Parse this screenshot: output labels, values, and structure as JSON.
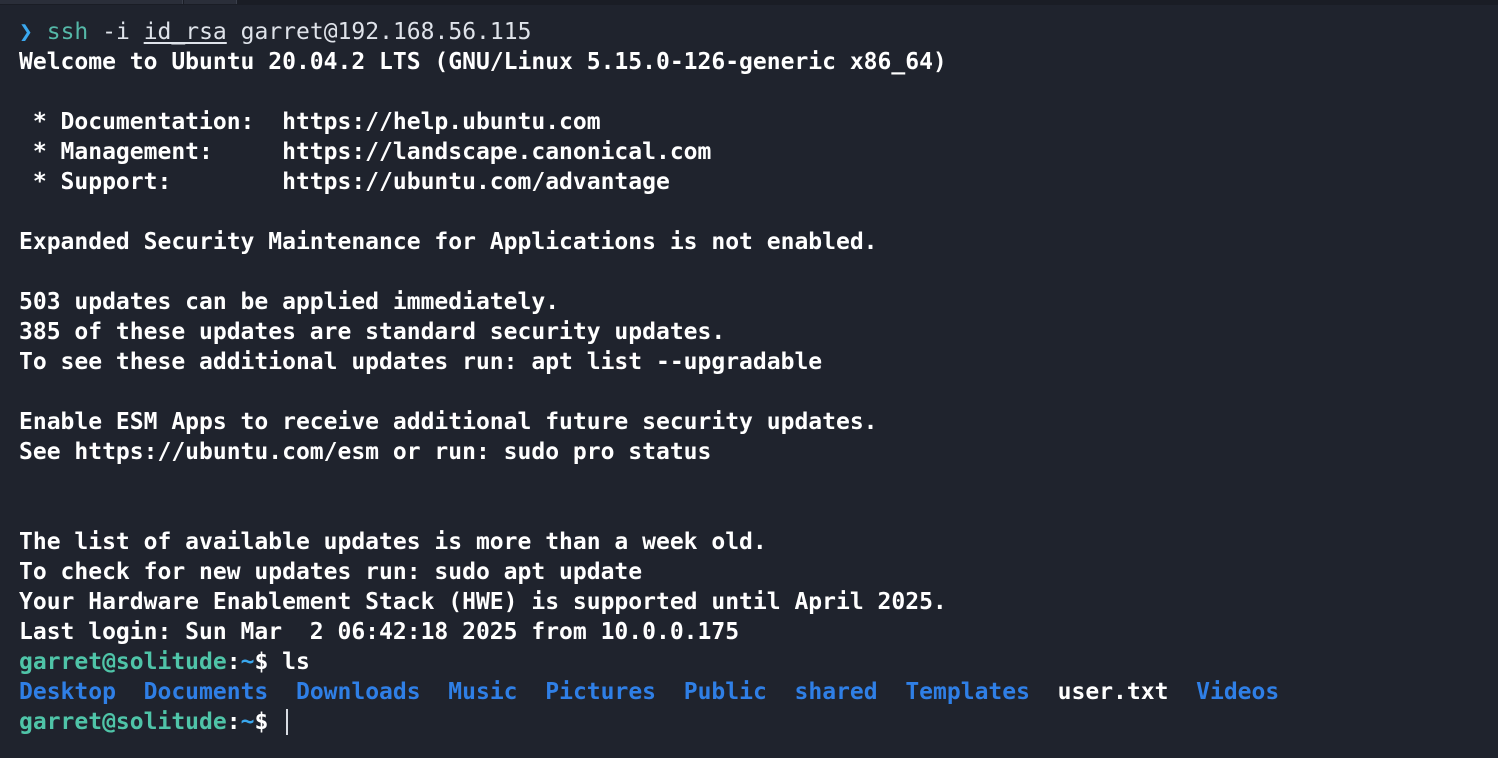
{
  "terminal": {
    "first_command": {
      "arrow": "❯",
      "command": "ssh",
      "flag": "-i",
      "key_file": "id_rsa",
      "host": "garret@192.168.56.115"
    },
    "motd_lines": [
      "Welcome to Ubuntu 20.04.2 LTS (GNU/Linux 5.15.0-126-generic x86_64)",
      "",
      " * Documentation:  https://help.ubuntu.com",
      " * Management:     https://landscape.canonical.com",
      " * Support:        https://ubuntu.com/advantage",
      "",
      "Expanded Security Maintenance for Applications is not enabled.",
      "",
      "503 updates can be applied immediately.",
      "385 of these updates are standard security updates.",
      "To see these additional updates run: apt list --upgradable",
      "",
      "Enable ESM Apps to receive additional future security updates.",
      "See https://ubuntu.com/esm or run: sudo pro status",
      "",
      "",
      "The list of available updates is more than a week old.",
      "To check for new updates run: sudo apt update",
      "Your Hardware Enablement Stack (HWE) is supported until April 2025.",
      "Last login: Sun Mar  2 06:42:18 2025 from 10.0.0.175"
    ],
    "prompt": {
      "user_host": "garret@solitude",
      "colon": ":",
      "path": "~",
      "dollar": "$"
    },
    "ls_command": "ls",
    "ls_output": [
      {
        "name": "Desktop",
        "kind": "dir"
      },
      {
        "name": "Documents",
        "kind": "dir"
      },
      {
        "name": "Downloads",
        "kind": "dir"
      },
      {
        "name": "Music",
        "kind": "dir"
      },
      {
        "name": "Pictures",
        "kind": "dir"
      },
      {
        "name": "Public",
        "kind": "dir"
      },
      {
        "name": "shared",
        "kind": "dir"
      },
      {
        "name": "Templates",
        "kind": "dir"
      },
      {
        "name": "user.txt",
        "kind": "file"
      },
      {
        "name": "Videos",
        "kind": "dir"
      }
    ],
    "colors": {
      "background": "#1f232d",
      "text": "#ffffff",
      "prompt_user": "#4fc4a8",
      "prompt_path": "#3aa8ef",
      "directory": "#2f7fe6",
      "command": "#55b8a8"
    }
  }
}
